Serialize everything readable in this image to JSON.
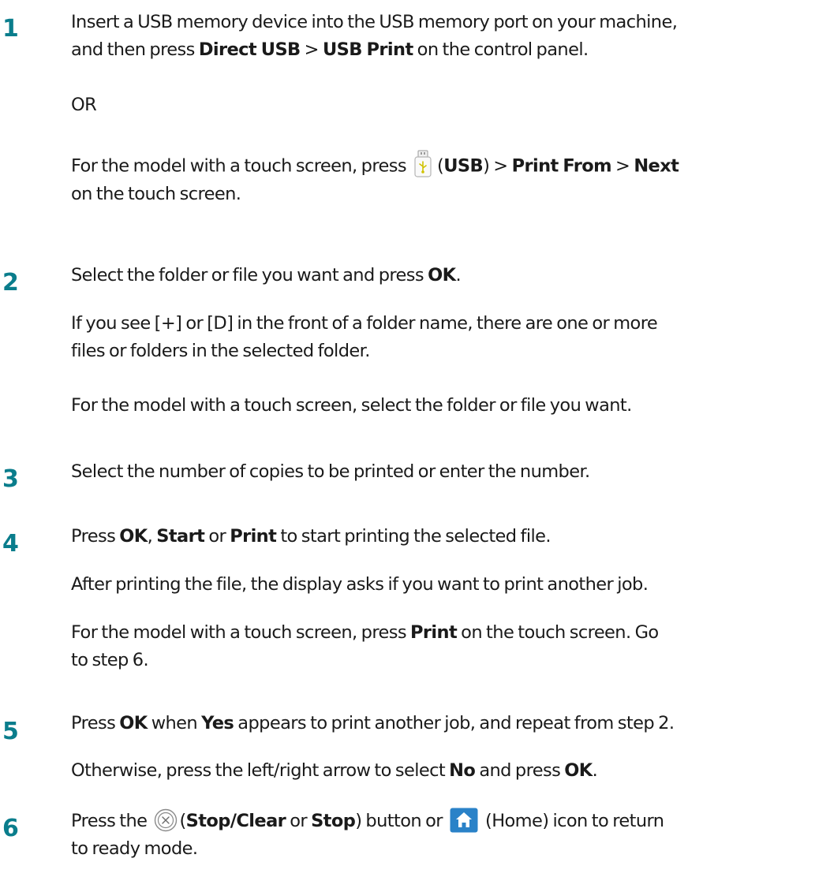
{
  "steps": [
    {
      "number": "1",
      "p1": {
        "line1": "Insert a USB memory device into the USB memory port on your machine,",
        "line2_a": "and then press ",
        "line2_b": "Direct USB",
        "line2_c": " > ",
        "line2_d": "USB Print",
        "line2_e": " on the control panel."
      },
      "or": "OR",
      "p3": {
        "a": "For the model with a touch screen, press ",
        "b": "(",
        "c": "USB",
        "d": ") > ",
        "e": "Print From",
        "f": " > ",
        "g": "Next",
        "line2": "on the touch screen."
      }
    },
    {
      "number": "2",
      "p1": {
        "a": "Select the folder or file you want and press ",
        "b": "OK",
        "c": "."
      },
      "p2": {
        "line1": "If you see [+] or [D] in the front of a folder name, there are one or more",
        "line2": "files or folders in the selected folder."
      },
      "p3": "For the model with a touch screen, select the folder or file you want."
    },
    {
      "number": "3",
      "p1": "Select the number of copies to be printed or enter the number."
    },
    {
      "number": "4",
      "p1": {
        "a": "Press ",
        "b": "OK",
        "c": ", ",
        "d": "Start",
        "e": " or ",
        "f": "Print",
        "g": " to start printing the selected file."
      },
      "p2": "After printing the file, the display asks if you want to print another job.",
      "p3": {
        "a": "For the model with a touch screen, press ",
        "b": "Print",
        "c": " on the touch screen. Go",
        "line2": "to step 6."
      }
    },
    {
      "number": "5",
      "p1": {
        "a": "Press ",
        "b": "OK",
        "c": " when ",
        "d": "Yes",
        "e": " appears to print another job, and repeat from step 2."
      },
      "p2": {
        "a": "Otherwise, press the left/right arrow to select ",
        "b": "No",
        "c": " and press ",
        "d": "OK",
        "e": "."
      }
    },
    {
      "number": "6",
      "p1": {
        "a": "Press the ",
        "b": "(",
        "c": "Stop/Clear",
        "d": " or ",
        "e": "Stop",
        "f": ") button or ",
        "g": " (Home) icon to return",
        "line2": "to ready mode."
      }
    }
  ],
  "colors": {
    "step_number": "#0a7d8c",
    "text": "#1a1a1a",
    "home_icon_bg": "#2a82c8"
  },
  "icons": {
    "usb": "usb-drive-icon",
    "stop": "stop-clear-icon",
    "home": "home-icon"
  }
}
